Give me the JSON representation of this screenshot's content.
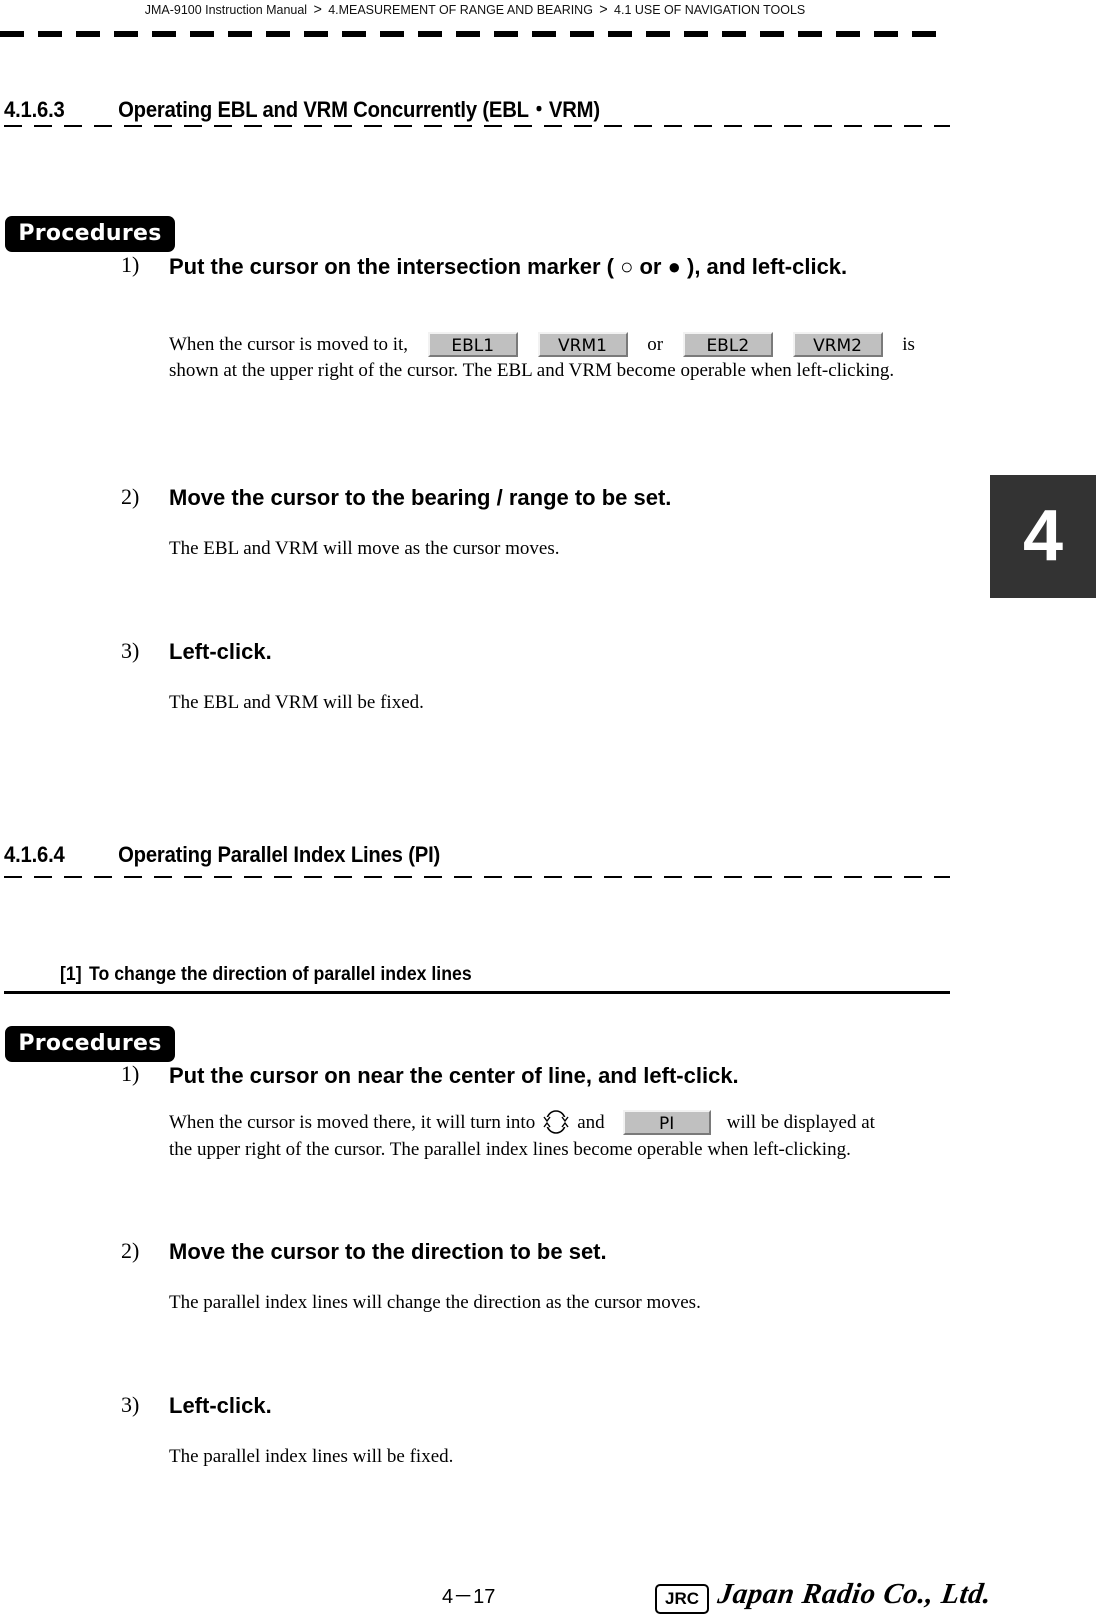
{
  "header": {
    "breadcrumb": [
      "JMA-9100 Instruction Manual",
      "4.MEASUREMENT OF RANGE AND BEARING",
      "4.1  USE OF NAVIGATION TOOLS"
    ],
    "separator": ">"
  },
  "chapter_tab": "4",
  "section1": {
    "number": "4.1.6.3",
    "title": "Operating EBL and VRM Concurrently (EBL・VRM)",
    "procedures_label": "Procedures",
    "steps": [
      {
        "num": "1)",
        "title": "Put the cursor on the intersection marker ( ○  or  ● ), and left-click.",
        "body_before": "When the cursor is moved to it,",
        "buttons": [
          "EBL1",
          "VRM1",
          "EBL2",
          "VRM2"
        ],
        "or_word": "or",
        "body_after_is": "is",
        "body_rest": "shown at the upper right of the cursor. The EBL and VRM become operable when left-clicking."
      },
      {
        "num": "2)",
        "title": "Move the cursor to the bearing / range to be set.",
        "body": "The EBL and VRM will move as the cursor moves."
      },
      {
        "num": "3)",
        "title": "Left-click.",
        "body": "The EBL and VRM will be fixed."
      }
    ]
  },
  "section2": {
    "number": "4.1.6.4",
    "title": "Operating Parallel Index Lines (PI)",
    "subsection": {
      "number": "[1]",
      "title": "To change the direction of parallel index lines"
    },
    "procedures_label": "Procedures",
    "steps": [
      {
        "num": "1)",
        "title": "Put the cursor on near the center of line, and left-click.",
        "body_before": "When the cursor is moved there, it will turn into",
        "icon": "rotate-cursor-icon",
        "and_word": "and",
        "button": "PI",
        "body_after": "will be displayed at",
        "body_rest": "the upper right of the cursor. The parallel index lines become operable when left-clicking."
      },
      {
        "num": "2)",
        "title": "Move the cursor to the direction to be set.",
        "body": "The parallel index lines will change the direction as the cursor moves."
      },
      {
        "num": "3)",
        "title": "Left-click.",
        "body": "The parallel index lines will be fixed."
      }
    ]
  },
  "footer": {
    "page": "4－17",
    "logo_mark": "JRC",
    "company": "Japan Radio Co., Ltd."
  },
  "colors": {
    "text": "#000000",
    "chapter_tab_bg": "#333333",
    "ui_button_bg": "#c0c0c0"
  }
}
